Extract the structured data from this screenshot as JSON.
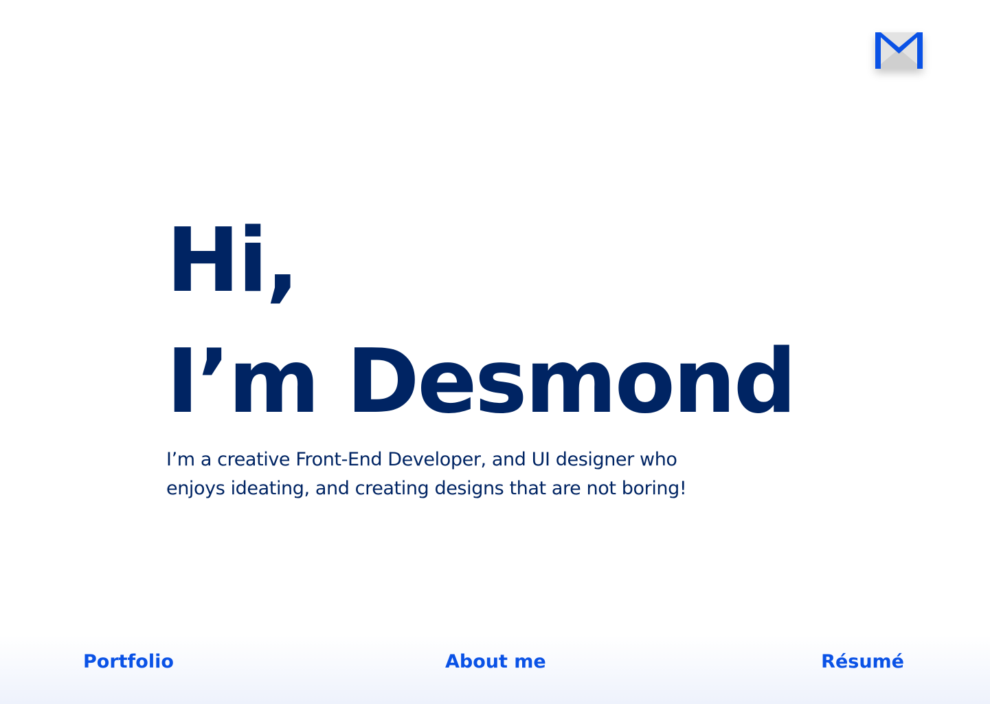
{
  "header": {
    "mail_icon": "mail-icon"
  },
  "hero": {
    "greeting": "Hi,",
    "name_line": "I’m Desmond",
    "intro_line_1": "I’m a creative Front-End Developer, and UI designer who",
    "intro_line_2": "enjoys ideating, and creating designs that are not boring!"
  },
  "nav": {
    "portfolio": "Portfolio",
    "about": "About me",
    "resume": "Résumé"
  },
  "colors": {
    "heading": "#002463",
    "link": "#0a52e6",
    "background": "#ffffff"
  }
}
